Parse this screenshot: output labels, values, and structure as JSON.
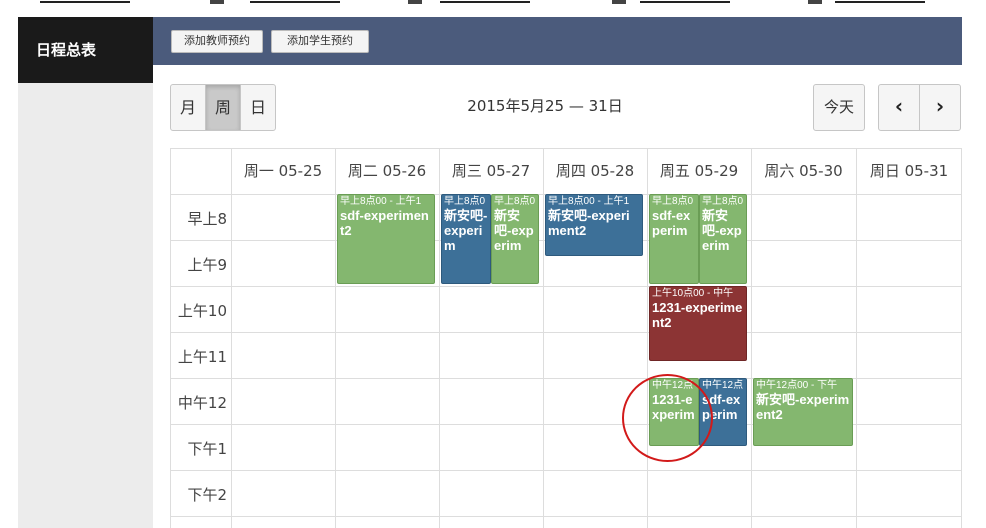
{
  "sidebar": {
    "active_item": "日程总表"
  },
  "toolbar": {
    "add_teacher": "添加教师预约",
    "add_student": "添加学生预约"
  },
  "view": {
    "month": "月",
    "week": "周",
    "day": "日",
    "selected": "周"
  },
  "range_title": "2015年5月25 — 31日",
  "today_label": "今天",
  "nav": {
    "prev": "‹",
    "next": "›"
  },
  "days": [
    "周一 05-25",
    "周二 05-26",
    "周三 05-27",
    "周四 05-28",
    "周五 05-29",
    "周六 05-30",
    "周日 05-31"
  ],
  "hours": [
    "早上8",
    "上午9",
    "上午10",
    "上午11",
    "中午12",
    "下午1",
    "下午2"
  ],
  "events": [
    {
      "day": "周二 05-26",
      "time": "早上8点00 - 上午1",
      "title": "sdf-experiment2",
      "color": "green"
    },
    {
      "day": "周三 05-27",
      "time": "早上8点0",
      "title": "新安吧-experim",
      "color": "blue"
    },
    {
      "day": "周三 05-27",
      "time": "早上8点0",
      "title": "新安吧-experim",
      "color": "green"
    },
    {
      "day": "周四 05-28",
      "time": "早上8点00 - 上午1",
      "title": "新安吧-experiment2",
      "color": "blue"
    },
    {
      "day": "周五 05-29",
      "time": "早上8点0",
      "title": "sdf-experim",
      "color": "green"
    },
    {
      "day": "周五 05-29",
      "time": "早上8点0",
      "title": "新安吧-experim",
      "color": "green"
    },
    {
      "day": "周五 05-29",
      "time": "上午10点00 - 中午",
      "title": "1231-experiment2",
      "color": "red"
    },
    {
      "day": "周五 05-29",
      "time": "中午12点",
      "title": "1231-experim",
      "color": "green"
    },
    {
      "day": "周五 05-29",
      "time": "中午12点",
      "title": "sdf-experim",
      "color": "blue"
    },
    {
      "day": "周六 05-30",
      "time": "中午12点00 - 下午",
      "title": "新安吧-experiment2",
      "color": "green"
    }
  ],
  "colors": {
    "header_bar": "#4b5b7c",
    "green": "#84b76f",
    "blue": "#3d7098",
    "red": "#8c3434",
    "annotation": "#d21a1a"
  }
}
